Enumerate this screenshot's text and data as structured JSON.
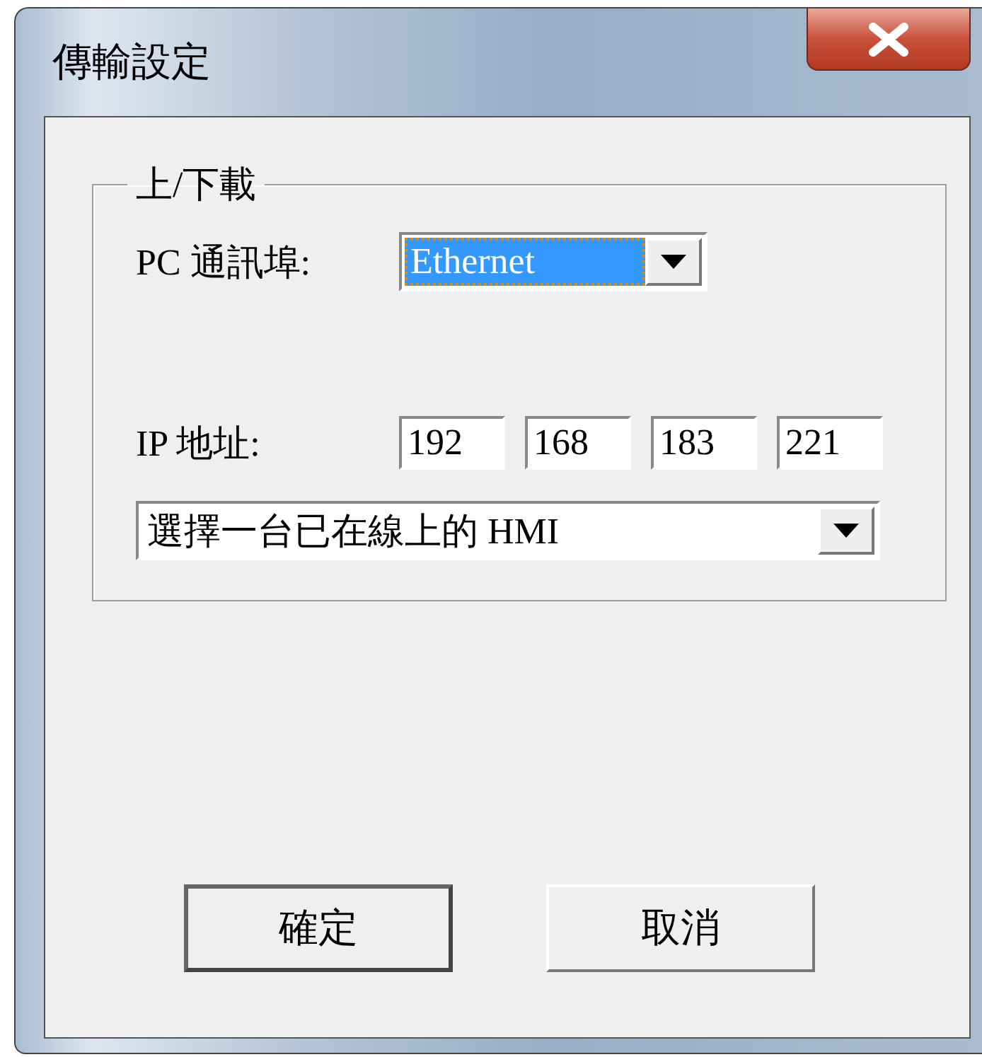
{
  "window": {
    "title": "傳輸設定"
  },
  "group": {
    "legend": "上/下載",
    "port": {
      "label": "PC 通訊埠:",
      "value": "Ethernet",
      "focused": true
    },
    "ip": {
      "label": "IP 地址:",
      "octets": [
        "192",
        "168",
        "183",
        "221"
      ]
    },
    "hmi": {
      "value": "選擇一台已在線上的 HMI"
    }
  },
  "buttons": [
    {
      "label": "確定",
      "default": true
    },
    {
      "label": "取消",
      "default": false
    }
  ]
}
